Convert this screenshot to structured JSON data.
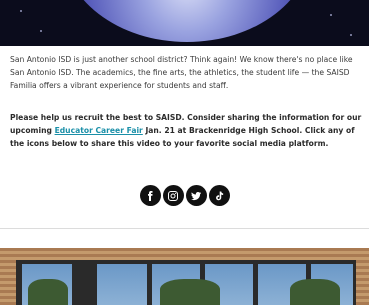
{
  "article": {
    "paragraph1": "San Antonio ISD is just another school district? Think again! We know there's no place like San Antonio ISD. The academics, the fine arts, the athletics, the student life — the SAISD Familia offers a vibrant experience for students and staff.",
    "paragraph2_before": "Please help us recruit the best to SAISD. Consider sharing the information for our upcoming ",
    "paragraph2_link": "Educator Career Fair",
    "paragraph2_after": " Jan. 21 at Brackenridge High School. Click any of the icons below to share this video to your favorite social media platform."
  },
  "social": {
    "icons": [
      "facebook-icon",
      "instagram-icon",
      "twitter-icon",
      "tiktok-icon"
    ]
  },
  "colors": {
    "link": "#1a8fa8",
    "icon_bg": "#111111"
  }
}
